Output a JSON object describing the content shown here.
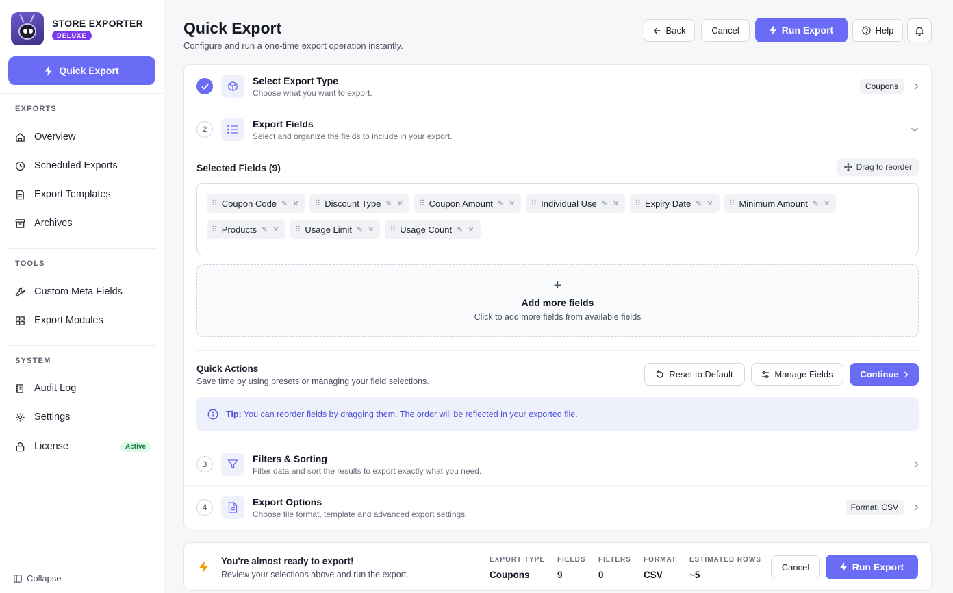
{
  "brand": {
    "name": "STORE EXPORTER",
    "badge": "DELUXE"
  },
  "sidebar": {
    "quick_export": "Quick Export",
    "sections": [
      {
        "title": "EXPORTS",
        "items": [
          {
            "label": "Overview",
            "icon": "home-icon"
          },
          {
            "label": "Scheduled Exports",
            "icon": "clock-icon"
          },
          {
            "label": "Export Templates",
            "icon": "document-icon"
          },
          {
            "label": "Archives",
            "icon": "archive-icon"
          }
        ]
      },
      {
        "title": "TOOLS",
        "items": [
          {
            "label": "Custom Meta Fields",
            "icon": "wrench-icon"
          },
          {
            "label": "Export Modules",
            "icon": "grid-icon"
          }
        ]
      },
      {
        "title": "SYSTEM",
        "items": [
          {
            "label": "Audit Log",
            "icon": "log-icon"
          },
          {
            "label": "Settings",
            "icon": "gear-icon"
          },
          {
            "label": "License",
            "icon": "lock-icon",
            "badge": "Active"
          }
        ]
      }
    ],
    "collapse": "Collapse"
  },
  "header": {
    "title": "Quick Export",
    "subtitle": "Configure and run a one-time export operation instantly.",
    "back": "Back",
    "cancel": "Cancel",
    "run_export": "Run Export",
    "help": "Help"
  },
  "steps": [
    {
      "num": "1",
      "title": "Select Export Type",
      "desc": "Choose what you want to export.",
      "tag": "Coupons",
      "status": "done"
    },
    {
      "num": "2",
      "title": "Export Fields",
      "desc": "Select and organize the fields to include in your export.",
      "status": "open"
    },
    {
      "num": "3",
      "title": "Filters & Sorting",
      "desc": "Filter data and sort the results to export exactly what you need."
    },
    {
      "num": "4",
      "title": "Export Options",
      "desc": "Choose file format, template and advanced export settings.",
      "tag": "Format: CSV"
    }
  ],
  "fields": {
    "selected_title": "Selected Fields (9)",
    "drag_label": "Drag to reorder",
    "chips": [
      "Coupon Code",
      "Discount Type",
      "Coupon Amount",
      "Individual Use",
      "Expiry Date",
      "Minimum Amount",
      "Products",
      "Usage Limit",
      "Usage Count"
    ],
    "add_title": "Add more fields",
    "add_desc": "Click to add more fields from available fields"
  },
  "quick_actions": {
    "title": "Quick Actions",
    "desc": "Save time by using presets or managing your field selections.",
    "reset": "Reset to Default",
    "manage": "Manage Fields",
    "continue": "Continue"
  },
  "tip": {
    "label": "Tip:",
    "text": "You can reorder fields by dragging them. The order will be reflected in your exported file."
  },
  "summary": {
    "title": "You're almost ready to export!",
    "desc": "Review your selections above and run the export.",
    "stats": [
      {
        "label": "EXPORT TYPE",
        "value": "Coupons"
      },
      {
        "label": "FIELDS",
        "value": "9"
      },
      {
        "label": "FILTERS",
        "value": "0"
      },
      {
        "label": "FORMAT",
        "value": "CSV"
      },
      {
        "label": "ESTIMATED ROWS",
        "value": "~5"
      }
    ],
    "cancel": "Cancel",
    "run_export": "Run Export"
  },
  "colors": {
    "accent": "#6b6cf6",
    "badge_purple": "#7c3aed",
    "active_green": "#15803d"
  }
}
